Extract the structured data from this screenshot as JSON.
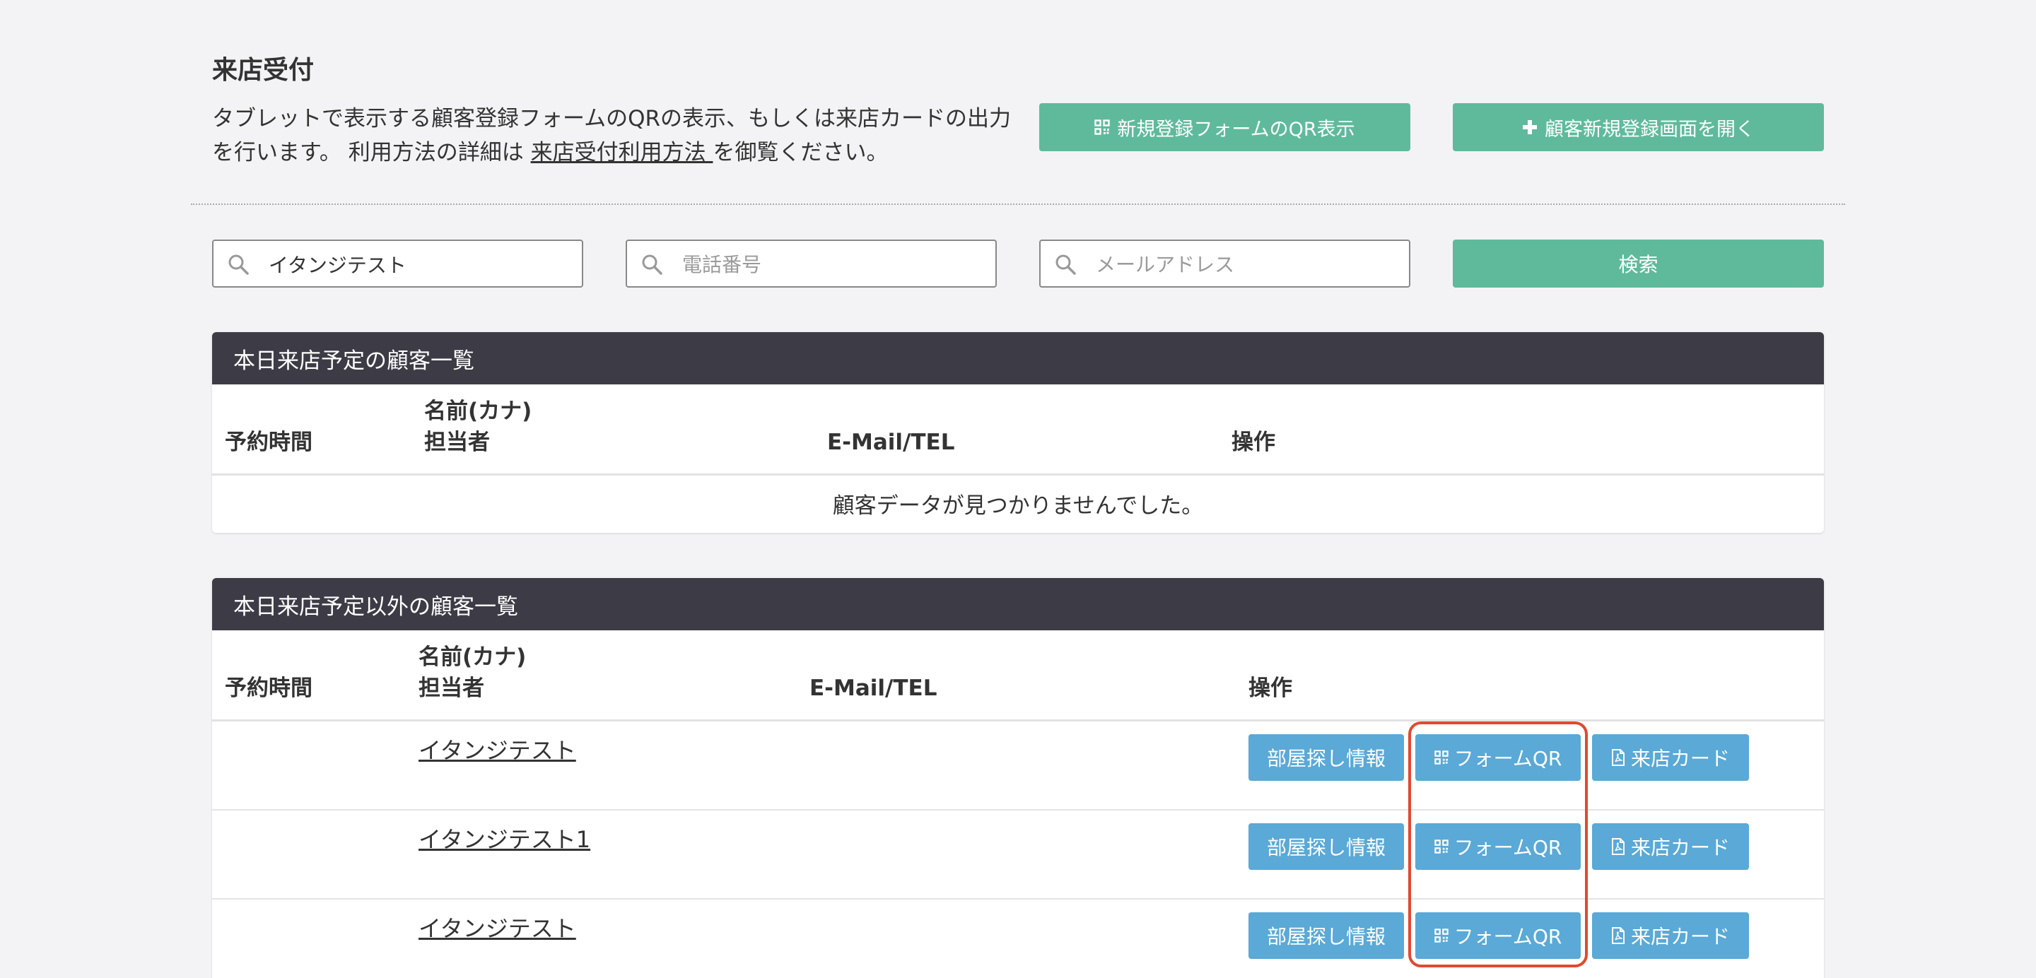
{
  "header": {
    "title": "来店受付",
    "description_pre": "タブレットで表示する顧客登録フォームのQRの表示、もしくは来店カードの出力を行います。 利用方法の詳細は ",
    "description_link": "来店受付利用方法 ",
    "description_post": "を御覧ください。",
    "qr_form_button": "新規登録フォームのQR表示",
    "new_customer_button": "顧客新規登録画面を開く"
  },
  "search": {
    "name_value": "イタンジテスト",
    "name_placeholder": "",
    "tel_placeholder": "電話番号",
    "mail_placeholder": "メールアドレス",
    "search_button": "検索"
  },
  "today_panel": {
    "title": "本日来店予定の顧客一覧",
    "columns": {
      "time": "予約時間",
      "name": "名前(カナ)",
      "staff": "担当者",
      "contact": "E-Mail/TEL",
      "actions": "操作"
    },
    "empty_message": "顧客データが見つかりませんでした。"
  },
  "other_panel": {
    "title": "本日来店予定以外の顧客一覧",
    "columns": {
      "time": "予約時間",
      "name": "名前(カナ)",
      "staff": "担当者",
      "contact": "E-Mail/TEL",
      "actions": "操作"
    },
    "rows": [
      {
        "name": "イタンジテスト"
      },
      {
        "name": "イタンジテスト1"
      },
      {
        "name": "イタンジテスト"
      }
    ],
    "actions": {
      "room": "部屋探し情報",
      "form_qr": "フォームQR",
      "card": "来店カード"
    }
  },
  "colors": {
    "green": "#5fba9b",
    "blue": "#5aa9d6",
    "panel_header": "#3d3b45",
    "highlight": "#e04a2f"
  }
}
